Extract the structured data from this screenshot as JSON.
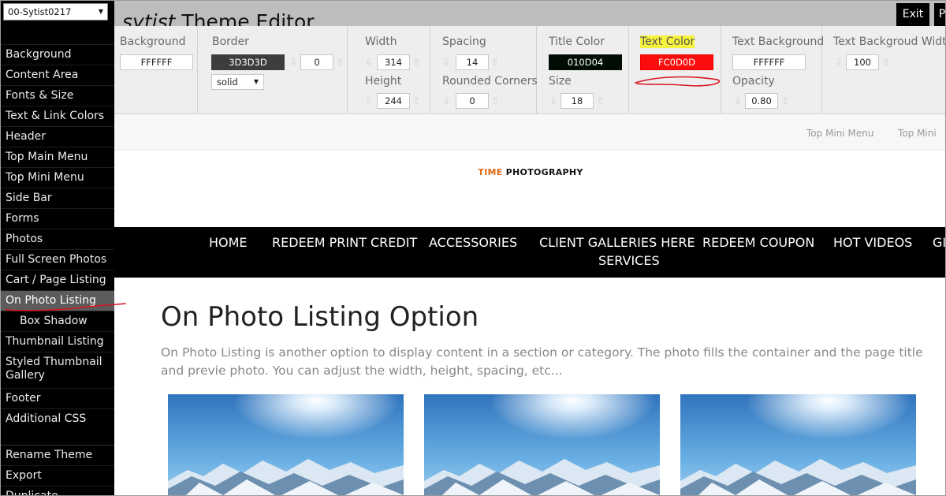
{
  "sidebar": {
    "theme_select": "00-Sytist0217",
    "items": [
      {
        "label": "Background"
      },
      {
        "label": "Content Area"
      },
      {
        "label": "Fonts & Size"
      },
      {
        "label": "Text & Link Colors"
      },
      {
        "label": "Header"
      },
      {
        "label": "Top Main Menu"
      },
      {
        "label": "Top Mini Menu"
      },
      {
        "label": "Side Bar"
      },
      {
        "label": "Forms"
      },
      {
        "label": "Photos"
      },
      {
        "label": "Full Screen Photos"
      },
      {
        "label": "Cart / Page Listing"
      },
      {
        "label": "On Photo Listing"
      },
      {
        "label": "Box Shadow"
      },
      {
        "label": "Thumbnail Listing"
      },
      {
        "label": "Styled Thumbnail Gallery"
      },
      {
        "label": "Footer"
      },
      {
        "label": "Additional CSS"
      }
    ],
    "actions": [
      {
        "label": "Rename Theme"
      },
      {
        "label": "Export"
      },
      {
        "label": "Duplicate"
      }
    ]
  },
  "topbar": {
    "title_brand": "sytist",
    "title_rest": " Theme Editor",
    "exit_label": "Exit",
    "extra_label": "P"
  },
  "panel": {
    "background": {
      "label": "Background",
      "value": "FFFFFF"
    },
    "border": {
      "label": "Border",
      "color": "3D3D3D",
      "width": "0",
      "style": "solid"
    },
    "width": {
      "label": "Width",
      "value": "314"
    },
    "height": {
      "label": "Height",
      "value": "244"
    },
    "spacing": {
      "label": "Spacing",
      "value": "14"
    },
    "rounded": {
      "label": "Rounded Corners",
      "value": "0"
    },
    "title_color": {
      "label": "Title Color",
      "value": "010D04"
    },
    "size": {
      "label": "Size",
      "value": "18"
    },
    "text_color": {
      "label": "Text Color",
      "value": "FC0D0D"
    },
    "text_background": {
      "label": "Text Background",
      "value": "FFFFFF"
    },
    "opacity": {
      "label": "Opacity",
      "value": "0.80"
    },
    "text_bg_width": {
      "label": "Text Backgroud Width",
      "value": "100"
    }
  },
  "preview": {
    "mini_menu": [
      "Top Mini Menu",
      "Top Mini"
    ],
    "logo_accent": "TIME",
    "logo_rest": " PHOTOGRAPHY",
    "menu": [
      "HOME",
      "REDEEM PRINT CREDIT",
      "ACCESSORIES",
      "CLIENT GALLERIES HERE",
      "REDEEM COUPON",
      "HOT VIDEOS",
      "GI",
      "SERVICES"
    ],
    "heading": "On Photo Listing Option",
    "description": "On Photo Listing is another option to display content in a section or category. The photo fills the container and the page title and previe photo. You can adjust the width, height, spacing, etc..."
  },
  "colors": {
    "sidebar_bg": "#000000",
    "active_item": "#5c5c5c",
    "text_color_swatch": "#FC0D0D",
    "title_color_swatch": "#010D04",
    "border_swatch": "#3D3D3D",
    "highlight": "#F7F33C",
    "annotation_red": "#D8141E",
    "logo_accent": "#E06B16"
  },
  "icons": {
    "dropdown": "chevron-down-icon",
    "decrement": "arrow-down-icon",
    "increment": "arrow-up-icon"
  }
}
